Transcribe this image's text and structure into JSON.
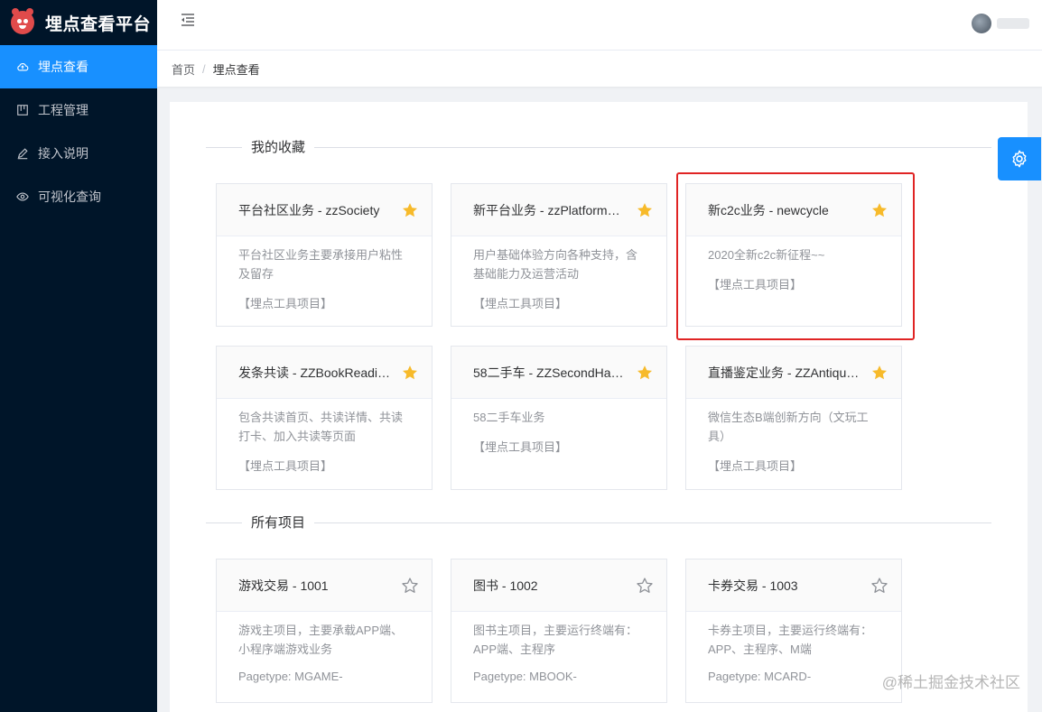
{
  "brand": {
    "title": "埋点查看平台"
  },
  "sidebar": {
    "items": [
      {
        "label": "埋点查看",
        "icon": "cloud-icon",
        "active": true
      },
      {
        "label": "工程管理",
        "icon": "project-icon",
        "active": false
      },
      {
        "label": "接入说明",
        "icon": "edit-icon",
        "active": false
      },
      {
        "label": "可视化查询",
        "icon": "eye-icon",
        "active": false
      }
    ]
  },
  "breadcrumb": {
    "home": "首页",
    "separator": "/",
    "current": "埋点查看"
  },
  "favorites": {
    "title": "我的收藏",
    "cards": [
      {
        "title": "平台社区业务 - zzSociety",
        "desc": "平台社区业务主要承接用户粘性及留存",
        "tag": "【埋点工具项目】",
        "starred": true
      },
      {
        "title": "新平台业务 - zzPlatform…",
        "desc": "用户基础体验方向各种支持，含基础能力及运营活动",
        "tag": "【埋点工具项目】",
        "starred": true
      },
      {
        "title": "新c2c业务 - newcycle",
        "desc": "2020全新c2c新征程~~",
        "tag": "【埋点工具项目】",
        "starred": true
      },
      {
        "title": "发条共读 - ZZBookReadi…",
        "desc": "包含共读首页、共读详情、共读打卡、加入共读等页面",
        "tag": "【埋点工具项目】",
        "starred": true
      },
      {
        "title": "58二手车 - ZZSecondHa…",
        "desc": "58二手车业务",
        "tag": "【埋点工具项目】",
        "starred": true
      },
      {
        "title": "直播鉴定业务 - ZZAntiqu…",
        "desc": "微信生态B端创新方向（文玩工具）",
        "tag": "【埋点工具项目】",
        "starred": true
      }
    ]
  },
  "all_projects": {
    "title": "所有项目",
    "cards": [
      {
        "title": "游戏交易 - 1001",
        "desc": "游戏主项目，主要承载APP端、小程序端游戏业务",
        "tag": "Pagetype: MGAME-",
        "starred": false
      },
      {
        "title": "图书 - 1002",
        "desc": "图书主项目，主要运行终端有：APP端、主程序",
        "tag": "Pagetype: MBOOK-",
        "starred": false
      },
      {
        "title": "卡券交易 - 1003",
        "desc": "卡券主项目，主要运行终端有：APP、主程序、M端",
        "tag": "Pagetype: MCARD-",
        "starred": false
      }
    ]
  },
  "watermark": "@稀土掘金技术社区",
  "colors": {
    "sidebar_bg": "#001529",
    "active_blue": "#1890ff",
    "star_gold": "#f7ba2a",
    "highlight_red": "#e02424"
  }
}
